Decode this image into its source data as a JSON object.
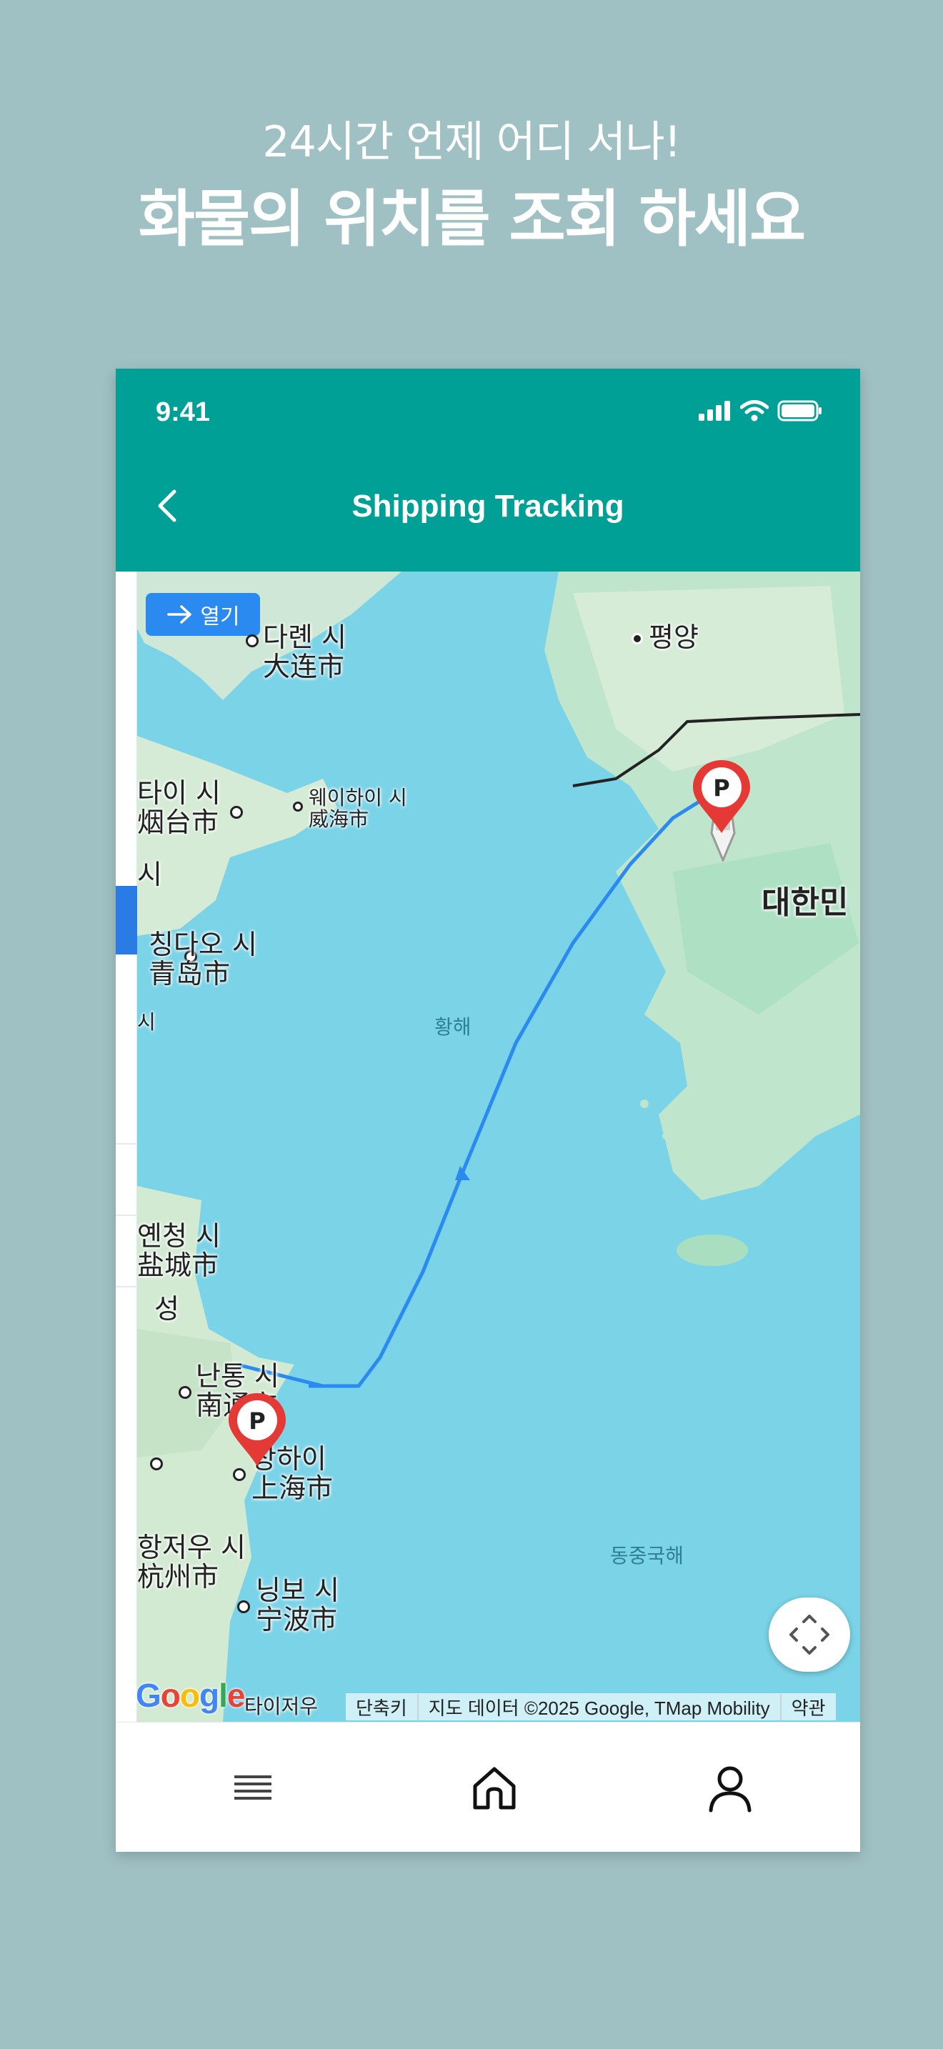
{
  "promo": {
    "subtitle": "24시간 언제 어디 서나!",
    "title": "화물의 위치를 조회 하세요"
  },
  "status_bar": {
    "time": "9:41"
  },
  "header": {
    "title": "Shipping Tracking",
    "back_icon": "chevron-left-icon"
  },
  "map": {
    "open_button": {
      "label": "열기",
      "icon": "arrow-right-icon"
    },
    "labels": {
      "dalian_ko": "다롄 시",
      "dalian_zh": "大连市",
      "pyongyang": "평양",
      "yantai_ko": "타이 시",
      "yantai_zh": "烟台市",
      "weihai_ko": "웨이하이 시",
      "weihai_zh": "威海市",
      "si1": "시",
      "qingdao_ko": "칭다오 시",
      "qingdao_zh": "青岛市",
      "si2": "시",
      "korea": "대한민",
      "yellow_sea": "황해",
      "yancheng_ko": "옌청 시",
      "yancheng_zh": "盐城市",
      "province": "성",
      "nantong_ko": "난통 시",
      "nantong_zh": "南通市",
      "shanghai_ko": "상하이",
      "shanghai_zh": "上海市",
      "hangzhou_ko": "항저우 시",
      "hangzhou_zh": "杭州市",
      "ningbo_ko": "닝보 시",
      "ningbo_zh": "宁波市",
      "east_china_sea": "동중국해",
      "taizhou": "타이저우"
    },
    "markers": [
      {
        "name": "destination-port",
        "letter": "P"
      },
      {
        "name": "origin-port",
        "letter": "P"
      }
    ],
    "route_color": "#2b8af0",
    "recenter_icon": "recenter-icon",
    "google_logo": "Google",
    "attribution": {
      "shortcuts": "단축키",
      "data": "지도 데이터 ©2025 Google, TMap Mobility",
      "terms": "약관"
    }
  },
  "bottom_nav": [
    {
      "icon": "menu-icon"
    },
    {
      "icon": "home-icon"
    },
    {
      "icon": "user-icon"
    }
  ],
  "colors": {
    "header": "#00a096",
    "background": "#a0c1c4",
    "accent": "#2b8af0",
    "marker": "#e53935"
  }
}
